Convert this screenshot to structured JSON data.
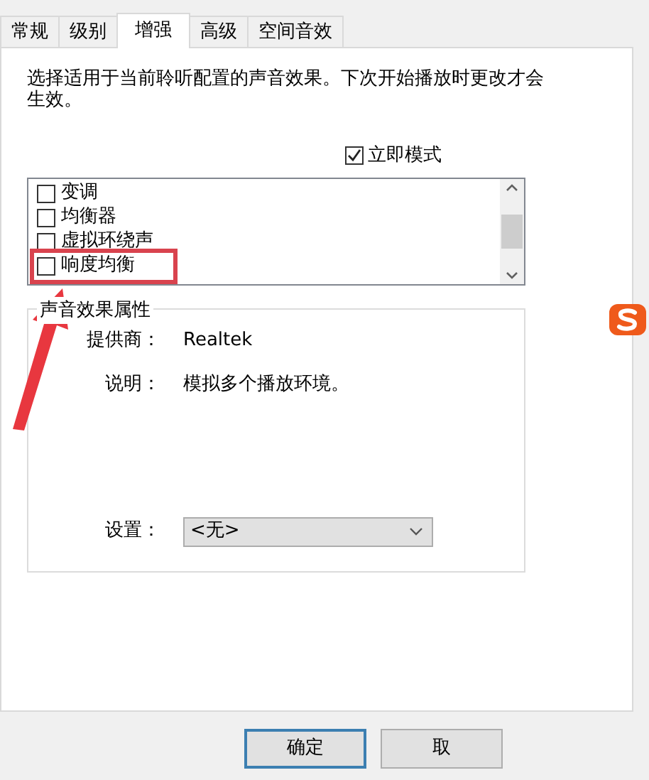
{
  "tabs": [
    {
      "label": "常规",
      "selected": false
    },
    {
      "label": "级别",
      "selected": false
    },
    {
      "label": "增强",
      "selected": true
    },
    {
      "label": "高级",
      "selected": false
    },
    {
      "label": "空间音效",
      "selected": false
    }
  ],
  "intro": "选择适用于当前聆听配置的声音效果。下次开始播放时更改才会生效。",
  "immediate_mode": {
    "label": "立即模式",
    "checked": true
  },
  "effects": [
    {
      "label": "变调",
      "checked": false,
      "highlighted": false
    },
    {
      "label": "均衡器",
      "checked": false,
      "highlighted": false
    },
    {
      "label": "虚拟环绕声",
      "checked": false,
      "highlighted": false
    },
    {
      "label": "响度均衡",
      "checked": false,
      "highlighted": true
    }
  ],
  "properties": {
    "title": "声音效果属性",
    "provider_label": "提供商：",
    "provider": "Realtek",
    "description_label": "说明：",
    "description": "模拟多个播放环境。",
    "settings_label": "设置：",
    "settings_value": "<无>"
  },
  "buttons": [
    {
      "label": "确定",
      "default": true
    },
    {
      "label": "取",
      "default": false
    }
  ]
}
